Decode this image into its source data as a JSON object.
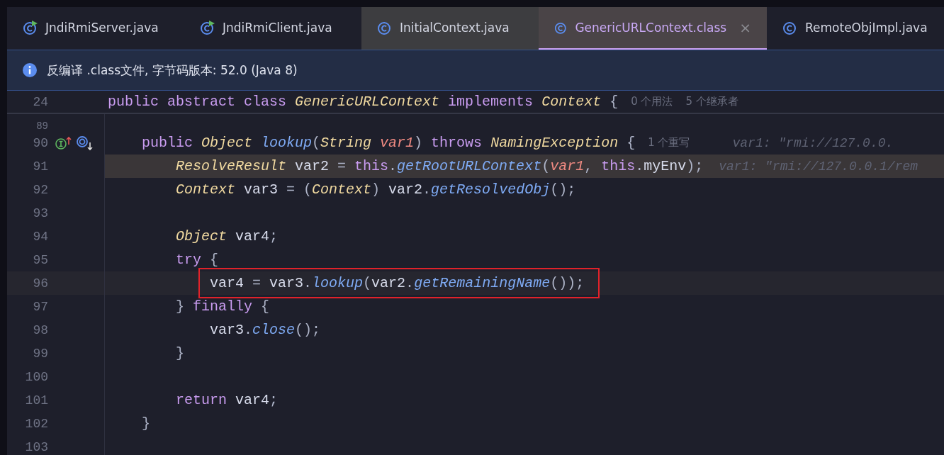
{
  "tabs": [
    {
      "label": "JndiRmiServer.java",
      "runnable": true,
      "selected": false,
      "hovered": false
    },
    {
      "label": "JndiRmiClient.java",
      "runnable": true,
      "selected": false,
      "hovered": false
    },
    {
      "label": "InitialContext.java",
      "runnable": false,
      "selected": false,
      "hovered": true
    },
    {
      "label": "GenericURLContext.class",
      "runnable": false,
      "selected": true,
      "hovered": false,
      "close": "×"
    },
    {
      "label": "RemoteObjImpl.java",
      "runnable": false,
      "selected": false,
      "hovered": false
    }
  ],
  "banner": {
    "text": "反编译 .class文件, 字节码版本: 52.0 (Java 8)"
  },
  "sticky_line": {
    "number": "24",
    "tokens": [
      {
        "kind": "kw",
        "text": "public abstract class "
      },
      {
        "kind": "type",
        "text": "GenericURLContext"
      },
      {
        "kind": "kw",
        "text": " implements "
      },
      {
        "kind": "type",
        "text": "Context"
      },
      {
        "kind": "punct",
        "text": " {"
      }
    ],
    "hints": [
      {
        "kind": "inlay",
        "text": "0 个用法"
      },
      {
        "kind": "inlay",
        "text": "5 个继承者"
      }
    ]
  },
  "lines": [
    {
      "number": "89",
      "kind": "partial",
      "executing": false,
      "caret": false,
      "gutter_icons": false,
      "boxed": false
    },
    {
      "number": "90",
      "kind": "code",
      "executing": false,
      "caret": false,
      "gutter_icons": true,
      "boxed": false,
      "tokens": [
        {
          "kind": "kw",
          "text": "public "
        },
        {
          "kind": "type",
          "text": "Object "
        },
        {
          "kind": "fn",
          "text": "lookup"
        },
        {
          "kind": "punct",
          "text": "("
        },
        {
          "kind": "type",
          "text": "String "
        },
        {
          "kind": "param",
          "text": "var1"
        },
        {
          "kind": "punct",
          "text": ") "
        },
        {
          "kind": "kw",
          "text": "throws "
        },
        {
          "kind": "type",
          "text": "NamingException"
        },
        {
          "kind": "punct",
          "text": " {"
        }
      ],
      "hints": [
        {
          "kind": "inlay",
          "text": "1 个重写"
        },
        {
          "kind": "value",
          "text": "var1: \"rmi://127.0.0."
        }
      ],
      "children": [
        {
          "number": "91",
          "kind": "code",
          "executing": true,
          "caret": false,
          "gutter_icons": false,
          "boxed": false,
          "tokens": [
            {
              "kind": "type",
              "text": "ResolveResult"
            },
            {
              "kind": "plain",
              "text": " var2 "
            },
            {
              "kind": "punct",
              "text": "= "
            },
            {
              "kind": "kw",
              "text": "this"
            },
            {
              "kind": "punct",
              "text": "."
            },
            {
              "kind": "fn",
              "text": "getRootURLContext"
            },
            {
              "kind": "punct",
              "text": "("
            },
            {
              "kind": "param",
              "text": "var1"
            },
            {
              "kind": "punct",
              "text": ", "
            },
            {
              "kind": "kw",
              "text": "this"
            },
            {
              "kind": "punct",
              "text": "."
            },
            {
              "kind": "plain",
              "text": "myEnv"
            },
            {
              "kind": "punct",
              "text": ");"
            }
          ],
          "hints": [
            {
              "kind": "value",
              "text": "var1: \"rmi://127.0.0.1/rem"
            }
          ]
        },
        {
          "number": "92",
          "kind": "code",
          "executing": false,
          "caret": false,
          "gutter_icons": false,
          "boxed": false,
          "tokens": [
            {
              "kind": "type",
              "text": "Context"
            },
            {
              "kind": "plain",
              "text": " var3 "
            },
            {
              "kind": "punct",
              "text": "= ("
            },
            {
              "kind": "type",
              "text": "Context"
            },
            {
              "kind": "punct",
              "text": ") "
            },
            {
              "kind": "plain",
              "text": "var2"
            },
            {
              "kind": "punct",
              "text": "."
            },
            {
              "kind": "fn",
              "text": "getResolvedObj"
            },
            {
              "kind": "punct",
              "text": "();"
            }
          ]
        },
        {
          "number": "93",
          "kind": "code",
          "executing": false,
          "caret": false,
          "gutter_icons": false,
          "boxed": false
        },
        {
          "number": "94",
          "kind": "code",
          "executing": false,
          "caret": false,
          "gutter_icons": false,
          "boxed": false,
          "tokens": [
            {
              "kind": "type",
              "text": "Object"
            },
            {
              "kind": "plain",
              "text": " var4"
            },
            {
              "kind": "punct",
              "text": ";"
            }
          ]
        },
        {
          "number": "95",
          "kind": "code",
          "executing": false,
          "caret": false,
          "gutter_icons": false,
          "boxed": false,
          "tokens": [
            {
              "kind": "kw",
              "text": "try"
            },
            {
              "kind": "punct",
              "text": " {"
            }
          ],
          "children": [
            {
              "number": "96",
              "kind": "code",
              "executing": false,
              "caret": true,
              "gutter_icons": false,
              "boxed": true,
              "tokens": [
                {
                  "kind": "plain",
                  "text": "var4 "
                },
                {
                  "kind": "punct",
                  "text": "= "
                },
                {
                  "kind": "plain",
                  "text": "var3"
                },
                {
                  "kind": "punct",
                  "text": "."
                },
                {
                  "kind": "fn",
                  "text": "lookup"
                },
                {
                  "kind": "punct",
                  "text": "("
                },
                {
                  "kind": "plain",
                  "text": "var2"
                },
                {
                  "kind": "punct",
                  "text": "."
                },
                {
                  "kind": "fn",
                  "text": "getRemainingName"
                },
                {
                  "kind": "punct",
                  "text": "());"
                }
              ]
            }
          ]
        },
        {
          "number": "97",
          "kind": "code",
          "executing": false,
          "caret": false,
          "gutter_icons": false,
          "boxed": false,
          "tokens": [
            {
              "kind": "punct",
              "text": "} "
            },
            {
              "kind": "kw",
              "text": "finally"
            },
            {
              "kind": "punct",
              "text": " {"
            }
          ],
          "children": [
            {
              "number": "98",
              "kind": "code",
              "executing": false,
              "caret": false,
              "gutter_icons": false,
              "boxed": false,
              "tokens": [
                {
                  "kind": "plain",
                  "text": "var3"
                },
                {
                  "kind": "punct",
                  "text": "."
                },
                {
                  "kind": "fn",
                  "text": "close"
                },
                {
                  "kind": "punct",
                  "text": "();"
                }
              ]
            }
          ]
        },
        {
          "number": "99",
          "kind": "code",
          "executing": false,
          "caret": false,
          "gutter_icons": false,
          "boxed": false,
          "tokens": [
            {
              "kind": "punct",
              "text": "}"
            }
          ]
        },
        {
          "number": "100",
          "kind": "code",
          "executing": false,
          "caret": false,
          "gutter_icons": false,
          "boxed": false
        },
        {
          "number": "101",
          "kind": "code",
          "executing": false,
          "caret": false,
          "gutter_icons": false,
          "boxed": false,
          "tokens": [
            {
              "kind": "kw",
              "text": "return"
            },
            {
              "kind": "plain",
              "text": " var4"
            },
            {
              "kind": "punct",
              "text": ";"
            }
          ]
        }
      ]
    },
    {
      "number": "102",
      "kind": "code",
      "executing": false,
      "caret": false,
      "gutter_icons": false,
      "boxed": false,
      "tokens": [
        {
          "kind": "punct",
          "text": "}"
        }
      ]
    },
    {
      "number": "103",
      "kind": "code",
      "executing": false,
      "caret": false,
      "gutter_icons": false,
      "boxed": false
    }
  ]
}
